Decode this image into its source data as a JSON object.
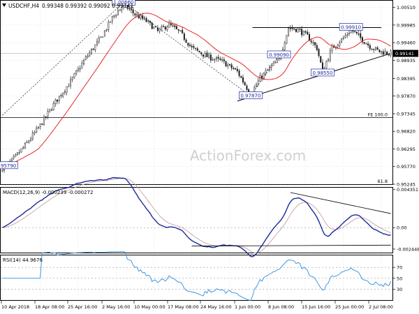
{
  "header": {
    "symbol": "USDCHF,H4",
    "ohlc": "0.99348 0.99392 0.99092 0.99141"
  },
  "watermark": "ActionForex.com",
  "colors": {
    "candle": "#1e1e1e",
    "ma": "#e8272a",
    "macd_main": "#1a2a9a",
    "macd_signal": "#c8a0a0",
    "rsi": "#2d8de0",
    "grid": "#c8c8c8",
    "trend": "#000000",
    "label_border": "#1a2a9a"
  },
  "chart_data": [
    {
      "type": "candlestick",
      "panel": "price",
      "ylim": [
        0.95245,
        1.0071
      ],
      "y_ticks": [
        "1.00510",
        "0.99985",
        "0.99460",
        "0.98935",
        "0.98395",
        "0.97870",
        "0.97345",
        "0.96820",
        "0.96295",
        "0.95770",
        "0.95245"
      ],
      "y_tick_values": [
        1.0051,
        0.99985,
        0.9946,
        0.98935,
        0.98395,
        0.9787,
        0.97345,
        0.9682,
        0.96295,
        0.9577,
        0.95245
      ],
      "current_price": "0.99141",
      "fib_label": "FE 100.0",
      "fib_value": 0.9723,
      "bottom_label": "61.8",
      "annotations": [
        {
          "text": "1.00660",
          "bar": 64,
          "price": 1.0066
        },
        {
          "text": "0.95790",
          "bar": 2,
          "price": 0.9579
        },
        {
          "text": "0.97870",
          "bar": 131,
          "price": 0.9787
        },
        {
          "text": "0.99090",
          "bar": 146,
          "price": 0.9909
        },
        {
          "text": "0.98550",
          "bar": 169,
          "price": 0.9855
        },
        {
          "text": "0.99910",
          "bar": 184,
          "price": 0.9991
        }
      ],
      "bar_count": 206
    },
    {
      "type": "line",
      "panel": "macd",
      "title": "MACD(12,26,9) -0.000239 -0.000272",
      "y_ticks": [
        "0.004351",
        "0.00",
        "-0.002448"
      ],
      "y_tick_values": [
        0.004351,
        0.0,
        -0.002448
      ],
      "ylim": [
        -0.00285,
        0.00455
      ]
    },
    {
      "type": "line",
      "panel": "rsi",
      "title": "RSI(14) 44.9676",
      "y_ticks": [
        "70",
        "50",
        "30"
      ],
      "y_tick_values": [
        70,
        50,
        30
      ],
      "ylim": [
        10,
        92
      ]
    }
  ],
  "x_axis": {
    "labels": [
      "10 Apr 2018",
      "18 Apr 08:00",
      "25 Apr 16:00",
      "2 May 16:00",
      "10 May 00:00",
      "17 May 08:00",
      "24 May 16:00",
      "1 Jun 00:00",
      "8 Jun 08:00",
      "15 Jun 16:00",
      "25 Jun 00:00",
      "2 Jul 08:00"
    ]
  }
}
